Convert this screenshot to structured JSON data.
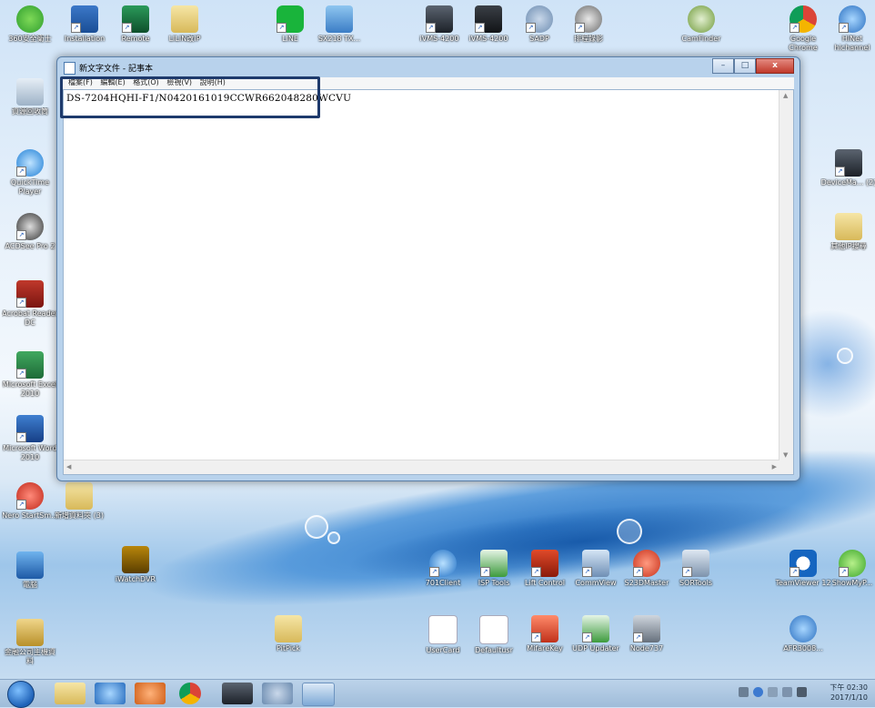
{
  "desktop": {
    "icons": [
      {
        "id": "360",
        "label": "360安全衛士"
      },
      {
        "id": "installation",
        "label": "Installation"
      },
      {
        "id": "remote",
        "label": "Remote"
      },
      {
        "id": "liln",
        "label": "LILIN改IP"
      },
      {
        "id": "line",
        "label": "LINE"
      },
      {
        "id": "sx218",
        "label": "SX218 TX..."
      },
      {
        "id": "ivms1",
        "label": "iVMS-4200"
      },
      {
        "id": "ivms2",
        "label": "iVMS-4200"
      },
      {
        "id": "sadp",
        "label": "SADP"
      },
      {
        "id": "daily",
        "label": "排程錄影"
      },
      {
        "id": "camfinder",
        "label": "CamFinder"
      },
      {
        "id": "chrome",
        "label": "Google Chrome"
      },
      {
        "id": "hinet",
        "label": "HiNet hichannel"
      },
      {
        "id": "recycle",
        "label": "資源回收筒"
      },
      {
        "id": "quicktime",
        "label": "QuickTime Player"
      },
      {
        "id": "acdsee",
        "label": "ACDSee Pro 2"
      },
      {
        "id": "acrobat",
        "label": "Acrobat Reader DC"
      },
      {
        "id": "excel",
        "label": "Microsoft Excel 2010"
      },
      {
        "id": "word",
        "label": "Microsoft Word 2010"
      },
      {
        "id": "nero",
        "label": "Nero StartSm..."
      },
      {
        "id": "newfolder",
        "label": "新增資料夾 (3)"
      },
      {
        "id": "computer",
        "label": "電腦"
      },
      {
        "id": "iwatch",
        "label": "iWatchDVR"
      },
      {
        "id": "devicema",
        "label": "DeviceMa... (2)"
      },
      {
        "id": "ipfolder",
        "label": "其他IP搜尋"
      },
      {
        "id": "client701",
        "label": "701Client"
      },
      {
        "id": "isptools",
        "label": "ISP Tools"
      },
      {
        "id": "liftcontrol",
        "label": "Lift Control"
      },
      {
        "id": "commview",
        "label": "CommView"
      },
      {
        "id": "s23d",
        "label": "S23DMaster"
      },
      {
        "id": "sortools",
        "label": "SORTools"
      },
      {
        "id": "teamviewer",
        "label": "TeamViewer 12"
      },
      {
        "id": "showmyp",
        "label": "ShowMyP..."
      },
      {
        "id": "pitpick",
        "label": "PitPick"
      },
      {
        "id": "usercard",
        "label": "UserCard"
      },
      {
        "id": "defaultusr",
        "label": "Defaultusr"
      },
      {
        "id": "mifarekey",
        "label": "MifareKey"
      },
      {
        "id": "udp",
        "label": "UDP Updater"
      },
      {
        "id": "node737",
        "label": "Node737"
      },
      {
        "id": "afr",
        "label": "AFR3008..."
      },
      {
        "id": "hualian",
        "label": "金融公司主機資料"
      }
    ]
  },
  "notepad": {
    "title": "新文字文件 - 記事本",
    "menu": [
      "檔案(F)",
      "編輯(E)",
      "格式(O)",
      "檢視(V)",
      "說明(H)"
    ],
    "content": "DS-7204HQHI-F1/N0420161019CCWR662048280WCVU",
    "buttons": {
      "minimize": "–",
      "maximize": "□",
      "close": "x"
    }
  },
  "taskbar": {
    "time": "下午 02:30",
    "date": "2017/1/10"
  },
  "colors": {
    "highlight_box": "#1e3a6c",
    "window_frame": "#b8d2ec"
  }
}
